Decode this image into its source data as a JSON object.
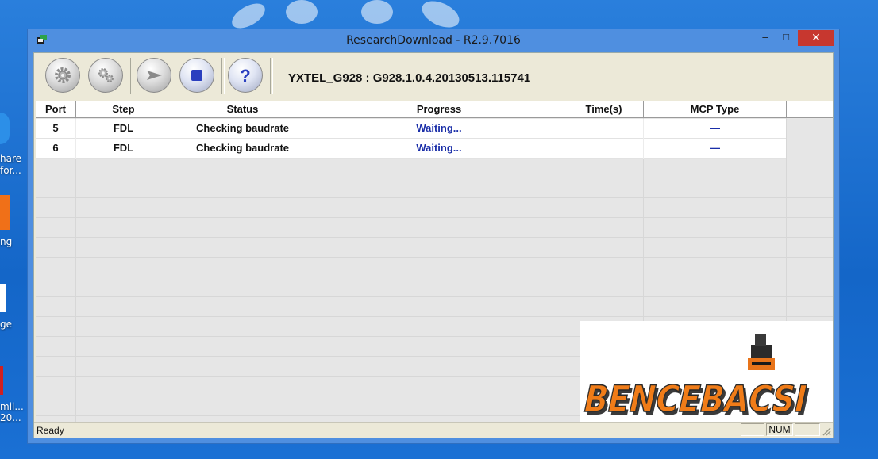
{
  "window": {
    "title": "ResearchDownload - R2.9.7016",
    "minimize": "–",
    "maximize": "□",
    "close": "✕"
  },
  "toolbar": {
    "buttons": [
      {
        "name": "load-packet-button",
        "icon": "gear-icon"
      },
      {
        "name": "settings-button",
        "icon": "gears-icon"
      },
      {
        "name": "start-download-button",
        "icon": "play-icon"
      },
      {
        "name": "stop-download-button",
        "icon": "stop-icon"
      },
      {
        "name": "help-button",
        "icon": "help-icon"
      }
    ],
    "device_info": "YXTEL_G928 : G928.1.0.4.20130513.115741"
  },
  "grid": {
    "columns": [
      "Port",
      "Step",
      "Status",
      "Progress",
      "Time(s)",
      "MCP Type"
    ],
    "rows": [
      {
        "port": "5",
        "step": "FDL",
        "status": "Checking baudrate",
        "progress": "Waiting...",
        "time": "",
        "mcp": "—"
      },
      {
        "port": "6",
        "step": "FDL",
        "status": "Checking baudrate",
        "progress": "Waiting...",
        "time": "",
        "mcp": "—"
      }
    ]
  },
  "logo": {
    "text": "BENCEBACSI"
  },
  "statusbar": {
    "text": "Ready",
    "panels": [
      "",
      "NUM",
      ""
    ]
  },
  "desktop": {
    "icon_labels": [
      "hare",
      "for...",
      "ng",
      "ge",
      "mil...",
      "20..."
    ]
  },
  "colors": {
    "accent_close": "#c7372f",
    "progress_text": "#1a2ea8",
    "logo_orange": "#f07c18"
  }
}
